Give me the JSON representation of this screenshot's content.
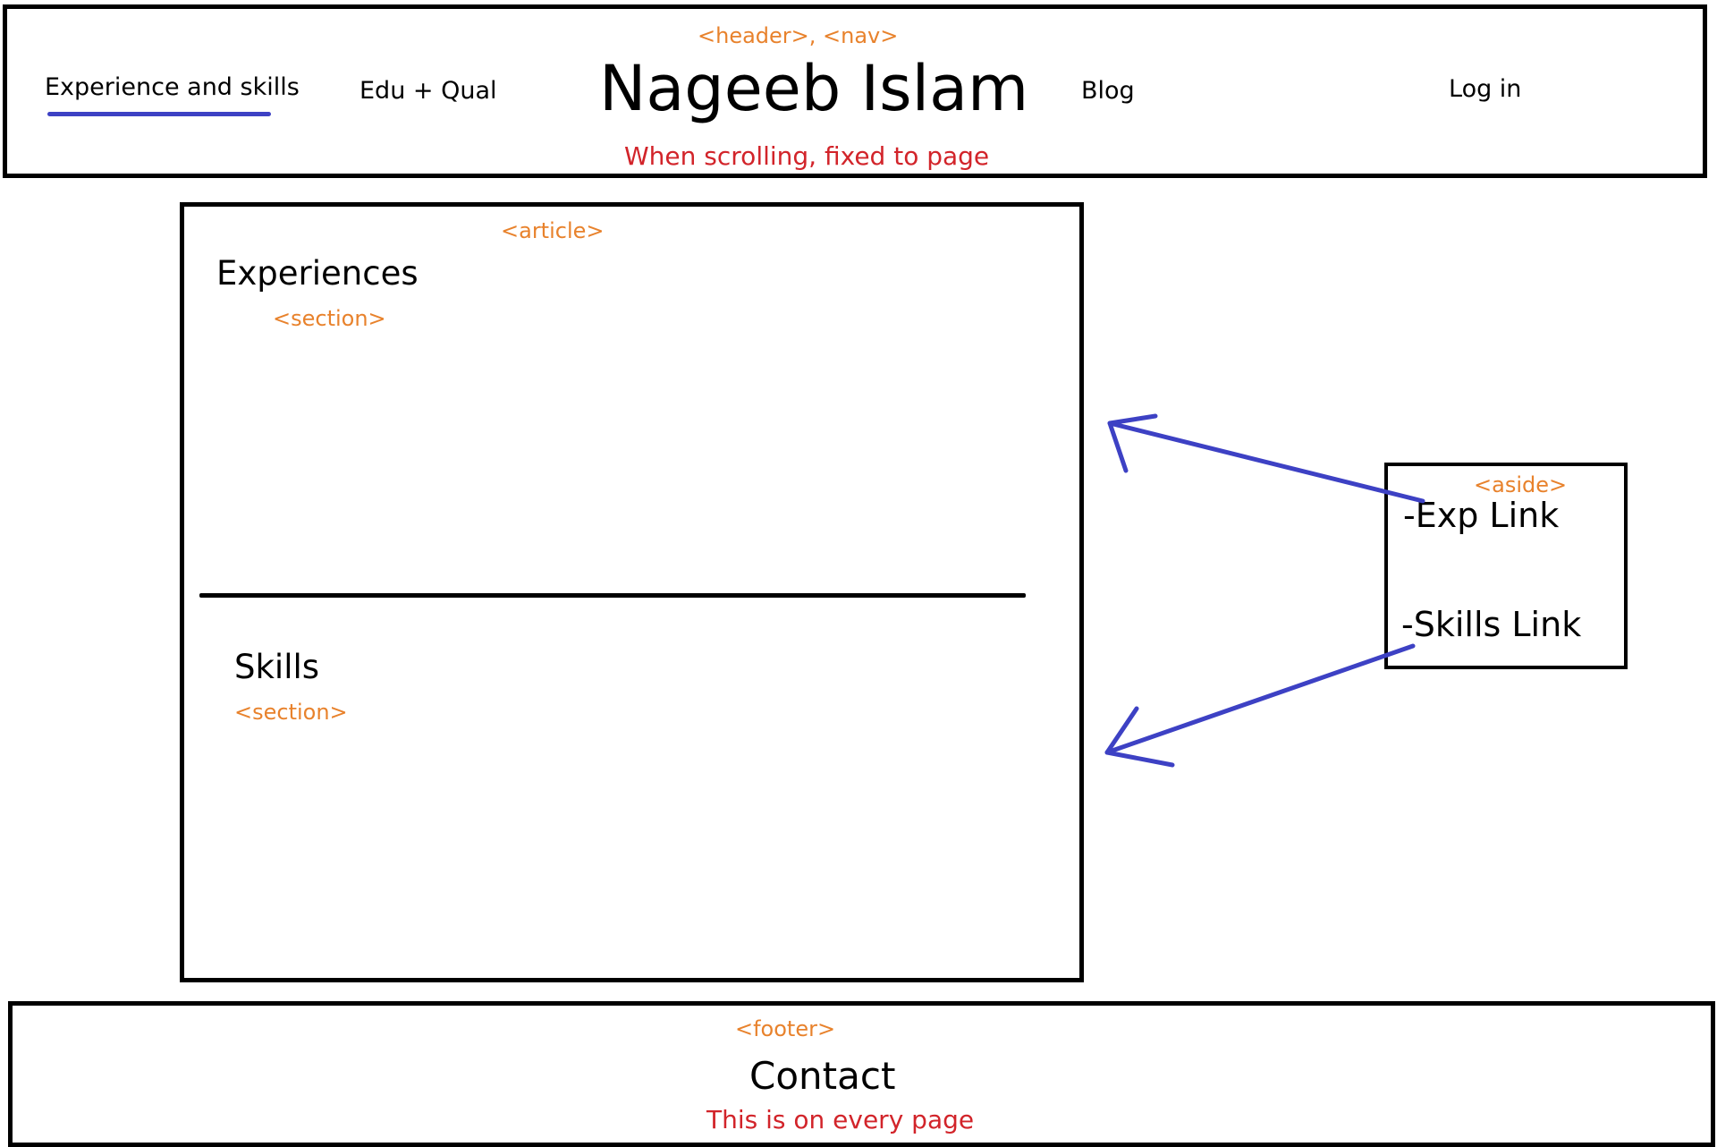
{
  "header": {
    "tag": "<header>, <nav>",
    "title": "Nageeb Islam",
    "nav": {
      "experience": "Experience and skills",
      "education": "Edu + Qual",
      "blog": "Blog",
      "login": "Log in"
    },
    "note": "When scrolling, fixed to page"
  },
  "article": {
    "tag": "<article>",
    "sections": [
      {
        "heading": "Experiences",
        "tag": "<section>"
      },
      {
        "heading": "Skills",
        "tag": "<section>"
      }
    ]
  },
  "aside": {
    "tag": "<aside>",
    "links": [
      "-Exp Link",
      "-Skills Link"
    ]
  },
  "footer": {
    "tag": "<footer>",
    "title": "Contact",
    "note": "This is on every page"
  },
  "colors": {
    "tag": "#e8822c",
    "note": "#d2242a",
    "arrow": "#3d41c4",
    "outline": "#000000"
  }
}
